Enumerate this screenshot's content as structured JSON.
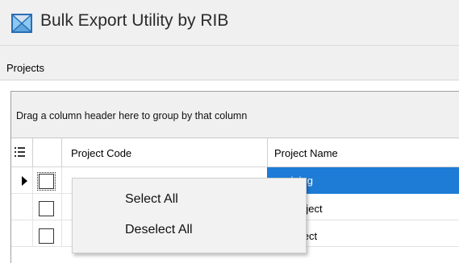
{
  "window": {
    "title": "Bulk Export Utility by RIB",
    "icon": "bulk-export-app-icon"
  },
  "menu": {
    "projects_label": "Projects"
  },
  "grid": {
    "group_panel_text": "Drag a column header here to group by that column",
    "column_chooser_icon": "column-chooser-icon",
    "columns": {
      "code": "Project Code",
      "name": "Project Name"
    },
    "rows": [
      {
        "checked": false,
        "name_visible": "…raining",
        "selected": true
      },
      {
        "checked": false,
        "name_visible": "…lt Project",
        "selected": false
      },
      {
        "checked": false,
        "name_visible": "… Project",
        "selected": false
      }
    ],
    "selection_color": "#1e7cd6"
  },
  "context_menu": {
    "items": [
      {
        "label": "Select All"
      },
      {
        "label": "Deselect All"
      }
    ]
  }
}
